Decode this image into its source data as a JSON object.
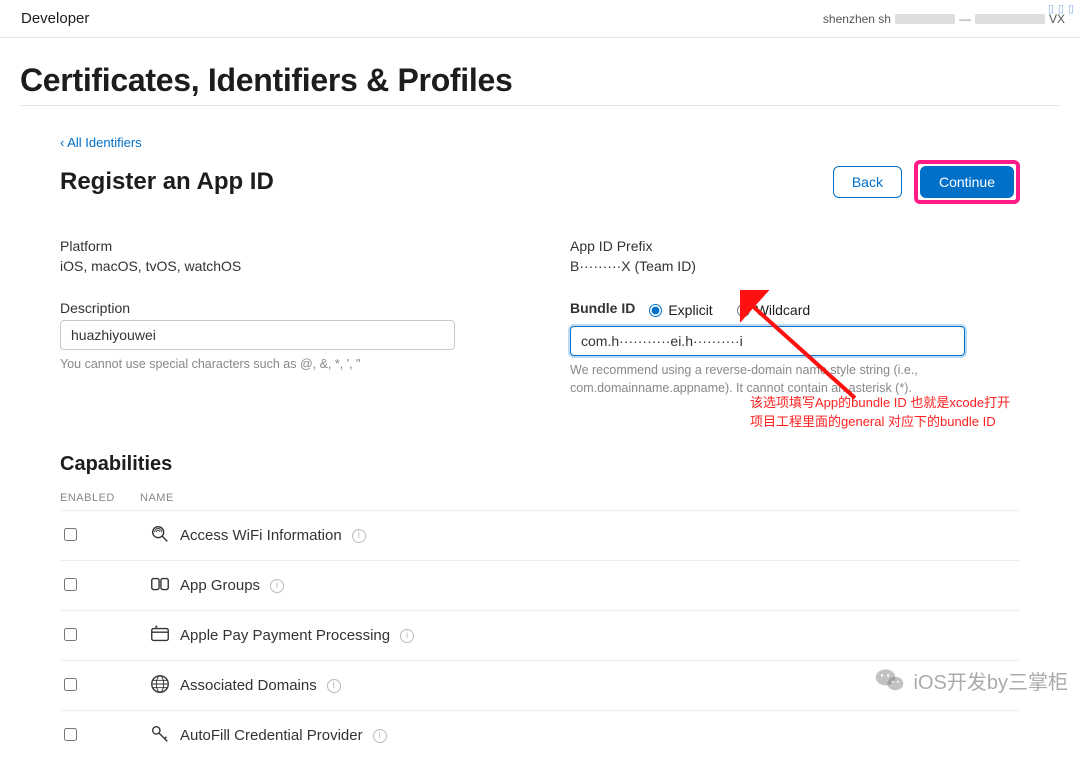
{
  "topbar": {
    "apple_glyph": "",
    "brand": "Developer",
    "account": "shenzhen sh"
  },
  "page": {
    "title": "Certificates, Identifiers & Profiles",
    "back_link": "‹ All Identifiers",
    "subtitle": "Register an App ID"
  },
  "buttons": {
    "back": "Back",
    "continue": "Continue"
  },
  "form": {
    "platform_label": "Platform",
    "platform_value": "iOS, macOS, tvOS, watchOS",
    "description_label": "Description",
    "description_value": "huazhiyouwei",
    "description_hint": "You cannot use special characters such as @, &, *, ', \"",
    "appid_prefix_label": "App ID Prefix",
    "appid_prefix_value": "B·········X (Team ID)",
    "bundle_label": "Bundle ID",
    "bundle_radio_explicit": "Explicit",
    "bundle_radio_wildcard": "Wildcard",
    "bundle_value": "com.h···········ei.h··········i",
    "bundle_hint": "We recommend using a reverse-domain name style string (i.e., com.domainname.appname). It cannot contain an asterisk (*)."
  },
  "capabilities": {
    "title": "Capabilities",
    "head_enabled": "ENABLED",
    "head_name": "NAME",
    "items": [
      {
        "name": "Access WiFi Information",
        "icon": "wifi-search"
      },
      {
        "name": "App Groups",
        "icon": "app-groups"
      },
      {
        "name": "Apple Pay Payment Processing",
        "icon": "apple-pay"
      },
      {
        "name": "Associated Domains",
        "icon": "globe"
      },
      {
        "name": "AutoFill Credential Provider",
        "icon": "key"
      }
    ]
  },
  "annotation": {
    "text_line1": "该选项填写App的bundle ID 也就是xcode打开",
    "text_line2": "项目工程里面的general 对应下的bundle ID"
  },
  "watermark": {
    "text": "iOS开发by三掌柜"
  }
}
